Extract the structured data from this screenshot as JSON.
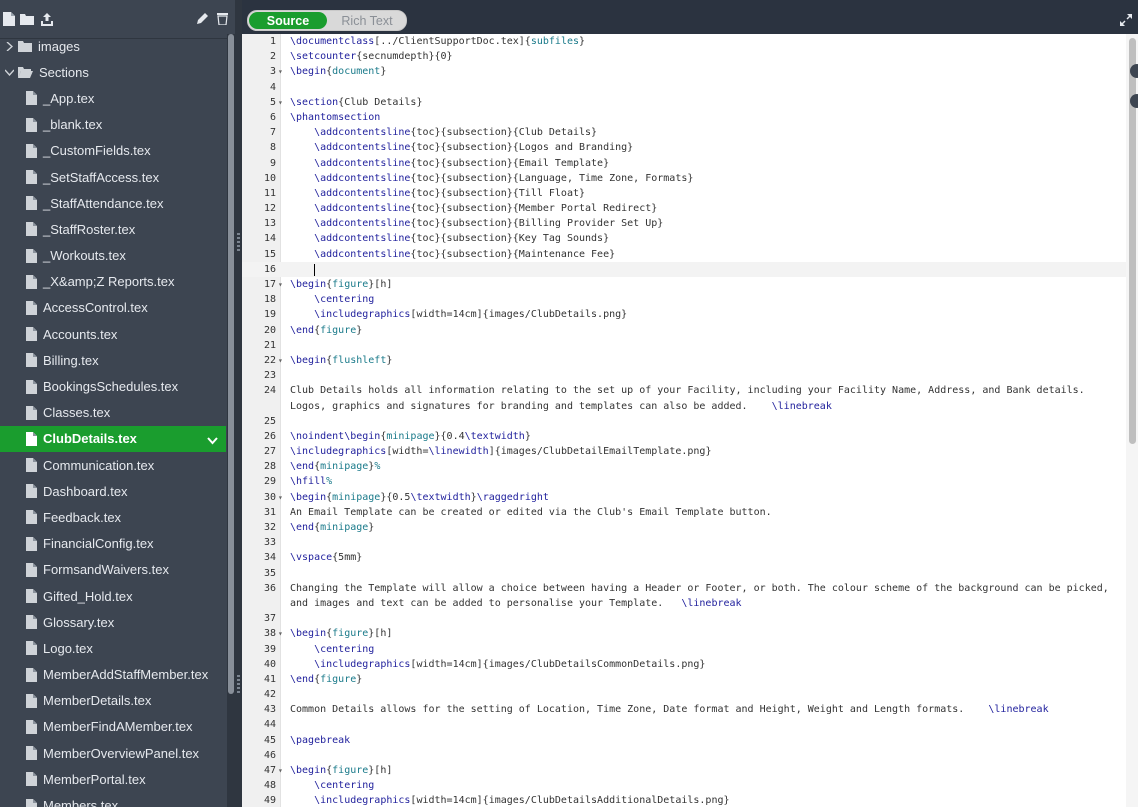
{
  "toolbar": {
    "icons": [
      "new-file-icon",
      "new-folder-icon",
      "upload-icon",
      "rename-icon",
      "delete-icon"
    ]
  },
  "view_toggle": {
    "source": "Source",
    "rich_text": "Rich Text",
    "active": "Source"
  },
  "file_tree": {
    "folders": [
      {
        "label": "images",
        "expanded": false
      },
      {
        "label": "Sections",
        "expanded": true
      }
    ],
    "files": [
      "_App.tex",
      "_blank.tex",
      "_CustomFields.tex",
      "_SetStaffAccess.tex",
      "_StaffAttendance.tex",
      "_StaffRoster.tex",
      "_Workouts.tex",
      "_X&amp;Z Reports.tex",
      "AccessControl.tex",
      "Accounts.tex",
      "Billing.tex",
      "BookingsSchedules.tex",
      "Classes.tex",
      "ClubDetails.tex",
      "Communication.tex",
      "Dashboard.tex",
      "Feedback.tex",
      "FinancialConfig.tex",
      "FormsandWaivers.tex",
      "Gifted_Hold.tex",
      "Glossary.tex",
      "Logo.tex",
      "MemberAddStaffMember.tex",
      "MemberDetails.tex",
      "MemberFindAMember.tex",
      "MemberOverviewPanel.tex",
      "MemberPortal.tex",
      "Members.tex"
    ],
    "selected": "ClubDetails.tex"
  },
  "editor": {
    "active_line": 16,
    "lines": [
      "\\documentclass[../ClientSupportDoc.tex]{subfiles}",
      "\\setcounter{secnumdepth}{0}",
      "\\begin{document}",
      "",
      "\\section{Club Details}",
      "\\phantomsection",
      "    \\addcontentsline{toc}{subsection}{Club Details}",
      "    \\addcontentsline{toc}{subsection}{Logos and Branding}",
      "    \\addcontentsline{toc}{subsection}{Email Template}",
      "    \\addcontentsline{toc}{subsection}{Language, Time Zone, Formats}",
      "    \\addcontentsline{toc}{subsection}{Till Float}",
      "    \\addcontentsline{toc}{subsection}{Member Portal Redirect}",
      "    \\addcontentsline{toc}{subsection}{Billing Provider Set Up}",
      "    \\addcontentsline{toc}{subsection}{Key Tag Sounds}",
      "    \\addcontentsline{toc}{subsection}{Maintenance Fee}",
      "    ",
      "\\begin{figure}[h]",
      "    \\centering",
      "    \\includegraphics[width=14cm]{images/ClubDetails.png}",
      "\\end{figure}",
      "",
      "\\begin{flushleft}",
      "",
      "Club Details holds all information relating to the set up of your Facility, including your Facility Name, Address, and Bank details.\nLogos, graphics and signatures for branding and templates can also be added.    \\linebreak",
      "",
      "\\noindent\\begin{minipage}{0.4\\textwidth}",
      "\\includegraphics[width=\\linewidth]{images/ClubDetailEmailTemplate.png}",
      "\\end{minipage}%",
      "\\hfill%",
      "\\begin{minipage}{0.5\\textwidth}\\raggedright",
      "An Email Template can be created or edited via the Club's Email Template button.",
      "\\end{minipage}",
      "",
      "\\vspace{5mm}",
      "",
      "Changing the Template will allow a choice between having a Header or Footer, or both. The colour scheme of the background can be picked,\nand images and text can be added to personalise your Template.   \\linebreak",
      "",
      "\\begin{figure}[h]",
      "    \\centering",
      "    \\includegraphics[width=14cm]{images/ClubDetailsCommonDetails.png}",
      "\\end{figure}",
      "",
      "Common Details allows for the setting of Location, Time Zone, Date format and Height, Weight and Length formats.    \\linebreak",
      "",
      "\\pagebreak",
      "",
      "\\begin{figure}[h]",
      "    \\centering",
      "    \\includegraphics[width=14cm]{images/ClubDetailsAdditionalDetails.png}"
    ],
    "fold_lines": [
      3,
      5,
      17,
      22,
      30,
      38,
      47
    ]
  },
  "colors": {
    "accent": "#1a9d2e",
    "sidebar": "#3d4551",
    "keyword": "#1f1f9c",
    "env": "#1a7a8a",
    "muted": "#7d9ccf"
  }
}
